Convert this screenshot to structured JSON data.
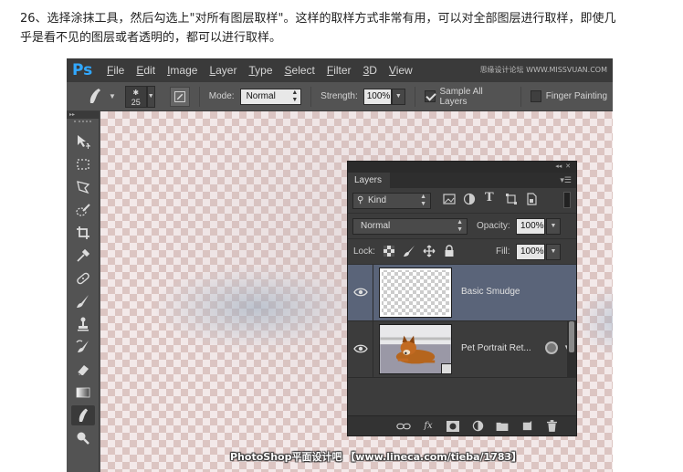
{
  "caption": {
    "line1": "26、选择涂抹工具，然后勾选上\"对所有图层取样\"。这样的取样方式非常有用，可以对全部图层进行取样，即使几",
    "line2": "乎是看不见的图层或者透明的，都可以进行取样。"
  },
  "app": {
    "logo": "Ps",
    "menu": [
      "File",
      "Edit",
      "Image",
      "Layer",
      "Type",
      "Select",
      "Filter",
      "3D",
      "View"
    ],
    "watermark_top": "思缘设计论坛 WWW.MISSVUAN.COM"
  },
  "options_bar": {
    "brush_size": "25",
    "mode_label": "Mode:",
    "mode_value": "Normal",
    "strength_label": "Strength:",
    "strength_value": "100%",
    "sample_all_layers_label": "Sample All Layers",
    "sample_all_layers_checked": true,
    "finger_painting_label": "Finger Painting",
    "finger_painting_checked": false
  },
  "tools": [
    "move-tool",
    "marquee-tool",
    "lasso-tool",
    "quick-selection-tool",
    "crop-tool",
    "eyedropper-tool",
    "healing-brush-tool",
    "brush-tool",
    "clone-stamp-tool",
    "history-brush-tool",
    "eraser-tool",
    "gradient-tool",
    "smudge-tool",
    "zoom-tool"
  ],
  "active_tool": "smudge-tool",
  "layers_panel": {
    "tab": "Layers",
    "filter_kind": "Kind",
    "blend_mode": "Normal",
    "opacity_label": "Opacity:",
    "opacity_value": "100%",
    "lock_label": "Lock:",
    "fill_label": "Fill:",
    "fill_value": "100%",
    "layers": [
      {
        "name": "Basic Smudge",
        "selected": true,
        "visible": true
      },
      {
        "name": "Pet Portrait Ret...",
        "selected": false,
        "visible": true
      }
    ]
  },
  "watermark_bottom": "PhotoShop平面设计吧 【www.lineca.com/tieba/1783】",
  "colors": {
    "ps_blue": "#31a8ff",
    "panel_bg": "#3c3c3c",
    "selected_layer": "#5a6479"
  }
}
